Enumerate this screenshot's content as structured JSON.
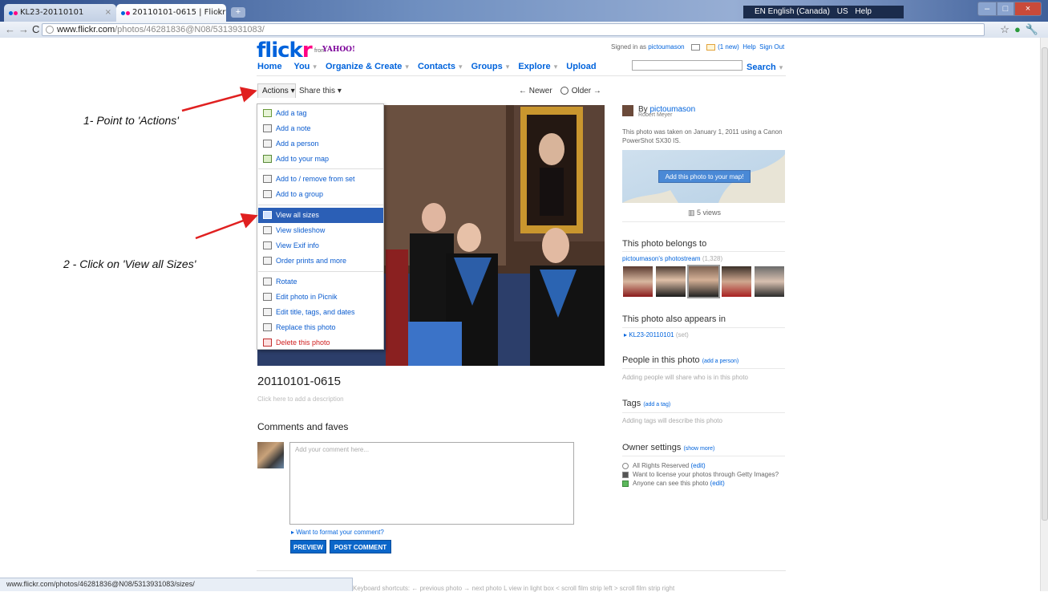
{
  "browser": {
    "tabs": [
      {
        "title": "KL23-20110101"
      },
      {
        "title": "20110101-0615 | Flickr - P..."
      }
    ],
    "url_domain": "www.flickr.com",
    "url_path": "/photos/46281836@N08/5313931083/",
    "language_bar": [
      "EN English (Canada)",
      "US",
      "Help"
    ],
    "status_url": "www.flickr.com/photos/46281836@N08/5313931083/sizes/"
  },
  "header": {
    "logo_blue": "flick",
    "logo_pink": "r",
    "from": "from",
    "yahoo": "YAHOO!",
    "nav": [
      "Home",
      "You",
      "Organize & Create",
      "Contacts",
      "Groups",
      "Explore",
      "Upload"
    ],
    "signed_in_as": "Signed in as",
    "username": "pictoumason",
    "new_mail": "(1 new)",
    "help": "Help",
    "sign_out": "Sign Out",
    "search_label": "Search"
  },
  "photo_toolbar": {
    "actions": "Actions",
    "share": "Share this",
    "newer": "← Newer",
    "older": "Older →"
  },
  "actions_menu": {
    "groups": [
      [
        "Add a tag",
        "Add a note",
        "Add a person",
        "Add to your map"
      ],
      [
        "Add to / remove from set",
        "Add to a group"
      ],
      [
        "View all sizes",
        "View slideshow",
        "View Exif info",
        "Order prints and more"
      ],
      [
        "Rotate",
        "Edit photo in Picnik",
        "Edit title, tags, and dates",
        "Replace this photo",
        "Delete this photo"
      ]
    ],
    "selected": "View all sizes"
  },
  "photo": {
    "title": "20110101-0615",
    "description_placeholder": "Click here to add a description"
  },
  "comments": {
    "heading": "Comments and faves",
    "placeholder": "Add your comment here...",
    "format_link": "Want to format your comment?",
    "preview": "PREVIEW",
    "post": "POST COMMENT"
  },
  "footer": {
    "shortcuts": "Keyboard shortcuts:  ← previous photo   → next photo   L view in light box   < scroll film strip left   > scroll film strip right"
  },
  "annotations": {
    "step1": "1- Point to 'Actions'",
    "step2": "2 - Click on 'View all Sizes'"
  },
  "sidebar": {
    "by": "By",
    "owner": "pictoumason",
    "real_name": "Robert Meyer",
    "taken": "This photo was taken on January 1, 2011 using a Canon PowerShot SX30 IS.",
    "map_button": "Add this photo to your map!",
    "views": "5 views",
    "belongs_heading": "This photo belongs to",
    "stream_link": "pictoumason's photostream",
    "stream_count": "(1,328)",
    "appears_heading": "This photo also appears in",
    "set_link": "KL23-20110101",
    "set_suffix": "(set)",
    "people_heading": "People in this photo",
    "people_add": "(add a person)",
    "people_text": "Adding people will share who is in this photo",
    "tags_heading": "Tags",
    "tags_add": "(add a tag)",
    "tags_text": "Adding tags will describe this photo",
    "owner_heading": "Owner settings",
    "owner_more": "(show more)",
    "rights": "All Rights Reserved",
    "rights_edit": "(edit)",
    "getty": "Want to license your photos through Getty Images?",
    "visibility": "Anyone can see this photo",
    "visibility_edit": "(edit)"
  },
  "colors": {
    "flickr_blue": "#0063dc",
    "flickr_pink": "#ff0084",
    "menu_selected": "#2b5fb6",
    "annotation_arrow": "#e02020"
  }
}
